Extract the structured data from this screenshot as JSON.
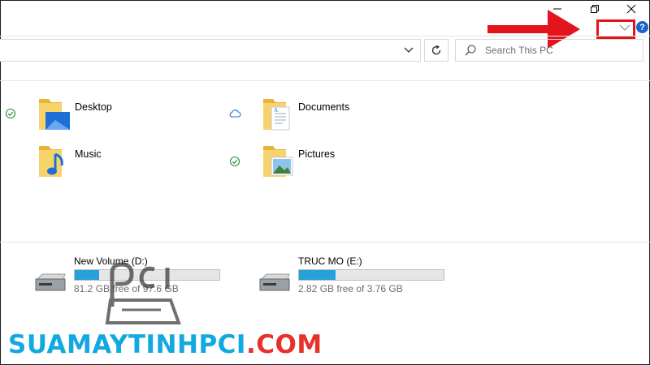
{
  "window": {
    "minimize_icon": "minimize-icon",
    "restore_icon": "restore-icon",
    "close_icon": "close-icon",
    "expand_ribbon_icon": "chevron-down-icon",
    "help_label": "?"
  },
  "search": {
    "placeholder": "Search This PC"
  },
  "folders": [
    {
      "label": "Desktop",
      "status": "synced-check"
    },
    {
      "label": "Documents",
      "status": "cloud"
    },
    {
      "label": "Music",
      "status": ""
    },
    {
      "label": "Pictures",
      "status": "synced-check"
    }
  ],
  "drives": [
    {
      "name": "New Volume (D:)",
      "free_text": "81.2 GB free of 97.6 GB",
      "used_fraction": 0.17
    },
    {
      "name": "TRUC MO (E:)",
      "free_text": "2.82 GB free of 3.76 GB",
      "used_fraction": 0.25
    }
  ],
  "annotation": {
    "arrow_color": "#e3141b",
    "highlight_color": "#e3141b"
  },
  "watermark": {
    "part1": "SUAMAYTINH",
    "part2": "PCI",
    "part3": ".COM",
    "logo": "pci"
  },
  "colors": {
    "accent": "#26a0da",
    "help": "#1a64c9",
    "check": "#2e8b3f"
  }
}
